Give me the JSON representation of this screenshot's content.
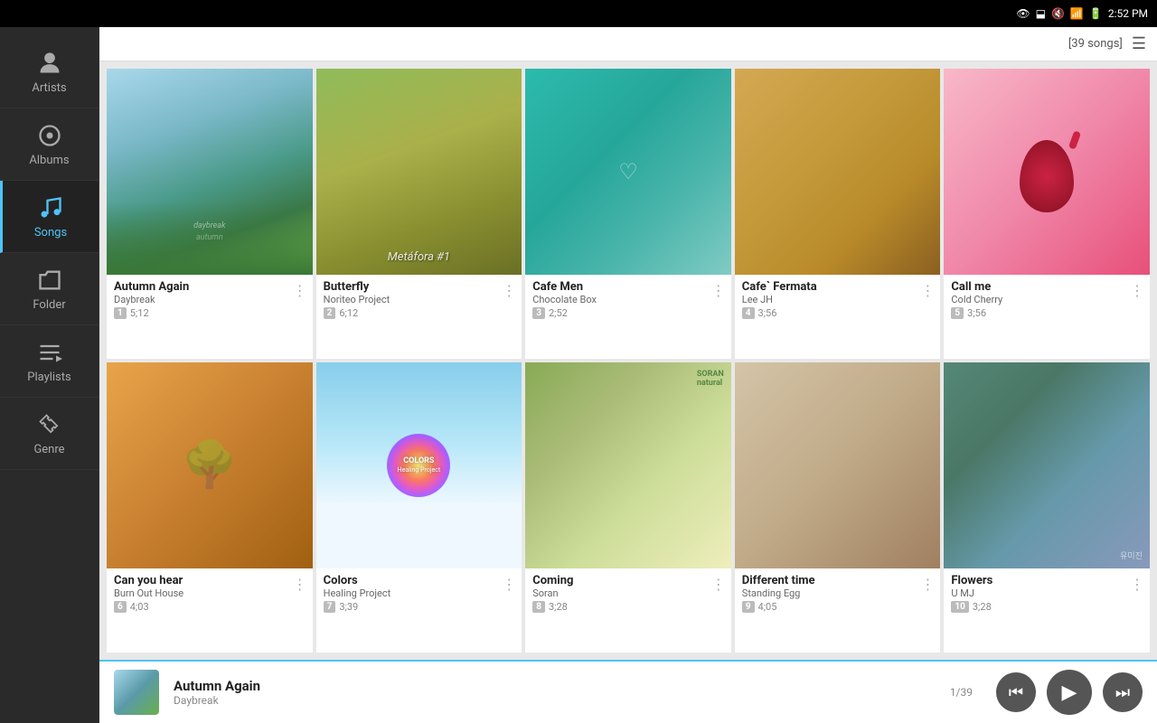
{
  "statusBar": {
    "time": "2:52 PM",
    "songCount": "[39 songs]"
  },
  "sidebar": {
    "items": [
      {
        "id": "artists",
        "label": "Artists",
        "icon": "person"
      },
      {
        "id": "albums",
        "label": "Albums",
        "icon": "album",
        "active": true
      },
      {
        "id": "songs",
        "label": "Songs",
        "icon": "music-note"
      },
      {
        "id": "folder",
        "label": "Folder",
        "icon": "folder"
      },
      {
        "id": "playlists",
        "label": "Playlists",
        "icon": "playlist"
      },
      {
        "id": "genre",
        "label": "Genre",
        "icon": "guitar"
      }
    ]
  },
  "albums": [
    {
      "id": 1,
      "title": "Autumn Again",
      "artist": "Daybreak",
      "trackNum": 1,
      "duration": "5;12",
      "artClass": "art-autumn"
    },
    {
      "id": 2,
      "title": "Butterfly",
      "artist": "Noriteo Project",
      "trackNum": 2,
      "duration": "6;12",
      "artClass": "art-butterfly",
      "artLabel": "Metáfora #1"
    },
    {
      "id": 3,
      "title": "Cafe Men",
      "artist": "Chocolate Box",
      "trackNum": 3,
      "duration": "2;52",
      "artClass": "art-cafemen"
    },
    {
      "id": 4,
      "title": "Cafe` Fermata",
      "artist": "Lee JH",
      "trackNum": 4,
      "duration": "3;56",
      "artClass": "art-cafe-fermata"
    },
    {
      "id": 5,
      "title": "Call me",
      "artist": "Cold Cherry",
      "trackNum": 5,
      "duration": "3;56",
      "artClass": "art-callme"
    },
    {
      "id": 6,
      "title": "Can you hear",
      "artist": "Burn Out House",
      "trackNum": 6,
      "duration": "4;03",
      "artClass": "art-canyouhear"
    },
    {
      "id": 7,
      "title": "Colors",
      "artist": "Healing Project",
      "trackNum": 7,
      "duration": "3;39",
      "artClass": "art-colors",
      "artLabel": "COLORS\nHealing Project"
    },
    {
      "id": 8,
      "title": "Coming",
      "artist": "Soran",
      "trackNum": 8,
      "duration": "3;28",
      "artClass": "art-coming"
    },
    {
      "id": 9,
      "title": "Different time",
      "artist": "Standing Egg",
      "trackNum": 9,
      "duration": "4;05",
      "artClass": "art-difftime"
    },
    {
      "id": 10,
      "title": "Flowers",
      "artist": "U MJ",
      "trackNum": 10,
      "duration": "3;28",
      "artClass": "art-flowers"
    }
  ],
  "nowPlaying": {
    "title": "Autumn Again",
    "artist": "Daybreak",
    "counter": "1/39"
  },
  "controls": {
    "prev": "⏮",
    "play": "▶",
    "next": "⏭"
  }
}
